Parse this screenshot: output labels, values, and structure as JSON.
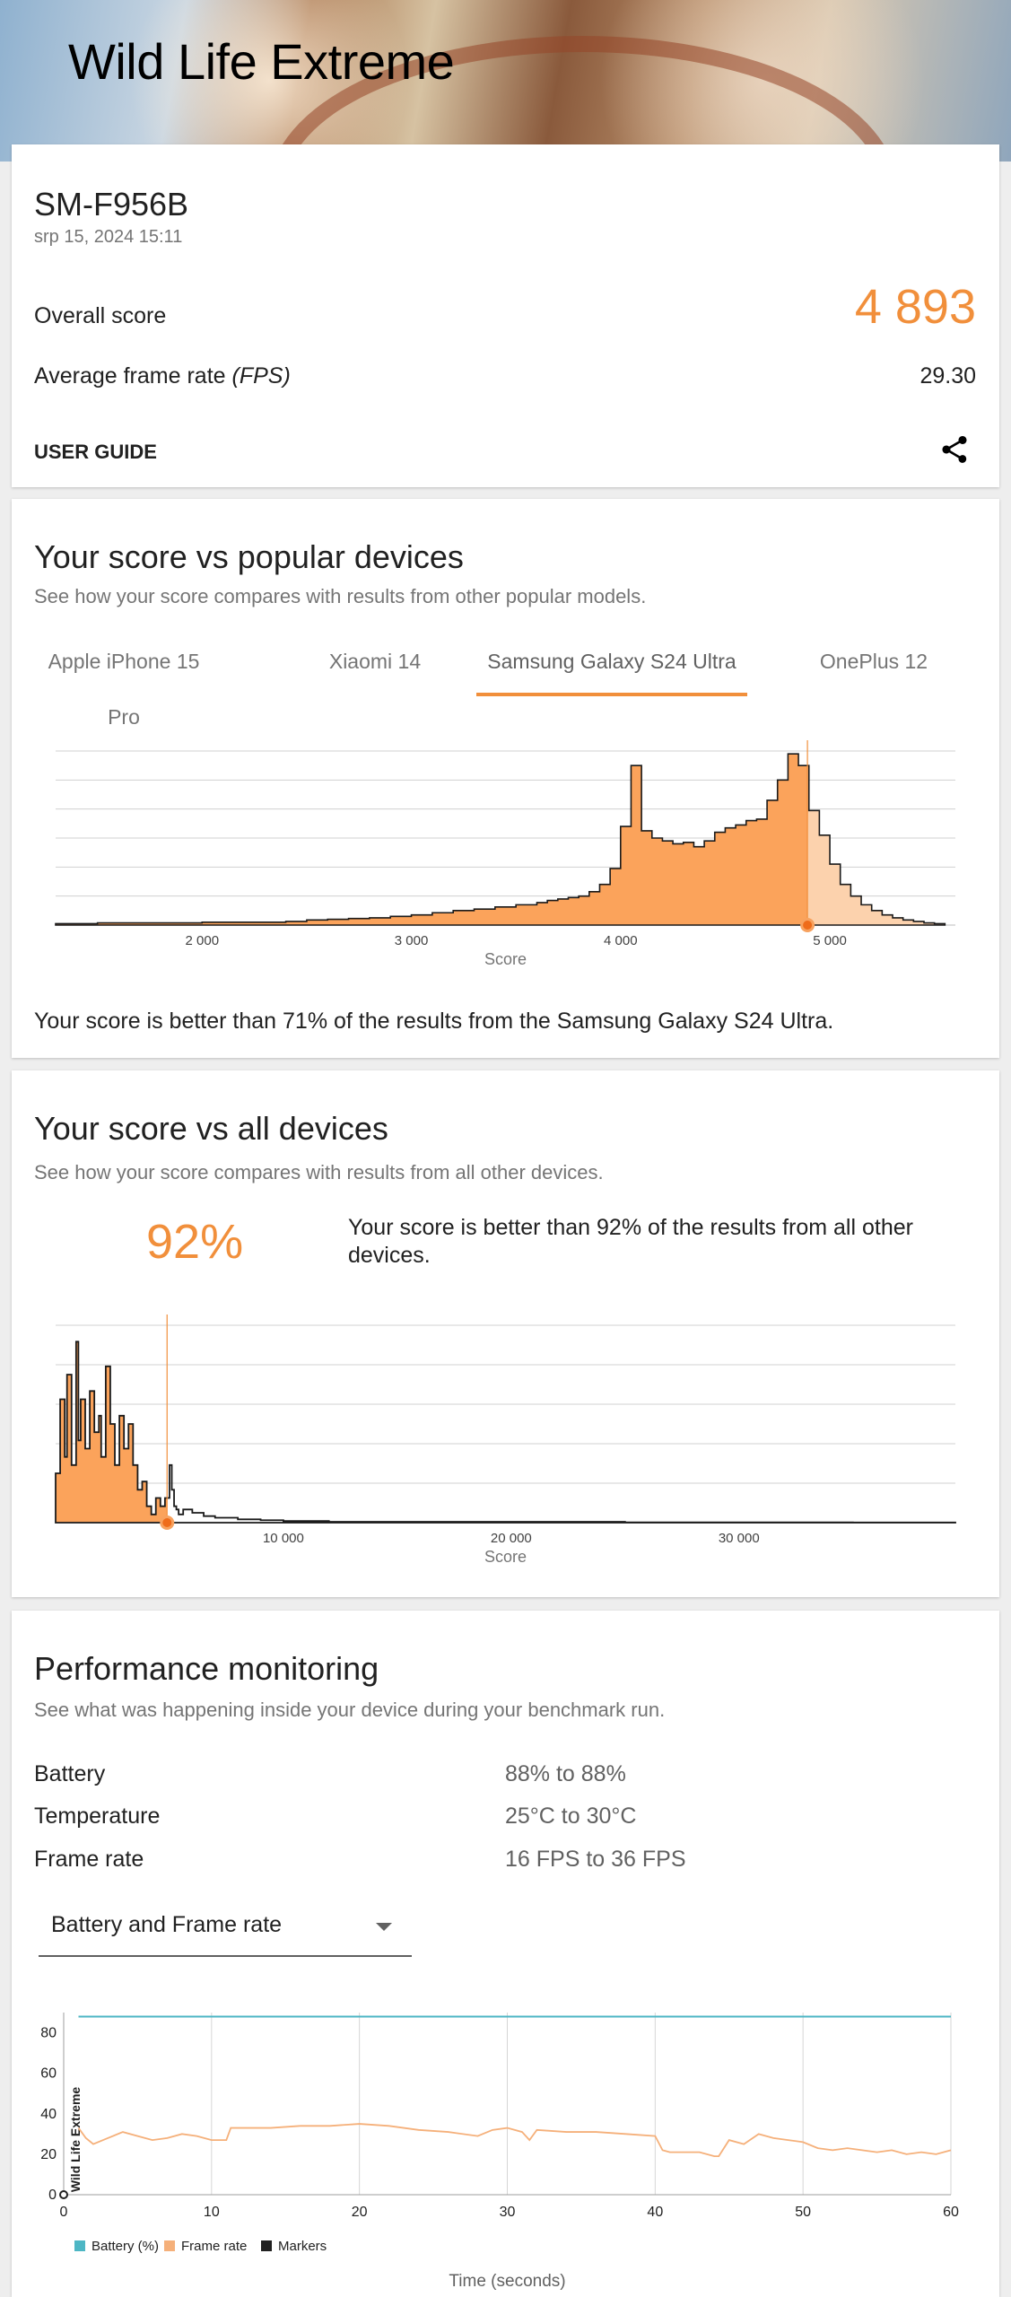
{
  "header": {
    "title": "Wild Life Extreme"
  },
  "summary": {
    "device": "SM-F956B",
    "date": "srp 15, 2024 15:11",
    "overall_label": "Overall score",
    "overall_value": "4 893",
    "fps_label": "Average frame rate",
    "fps_unit": "(FPS)",
    "fps_value": "29.30",
    "user_guide": "USER GUIDE",
    "share_icon": "share-icon",
    "accent_color": "#f18f3b"
  },
  "popular": {
    "title": "Your score vs popular devices",
    "subtitle": "See how your score compares with results from other popular models.",
    "tabs": [
      "Apple iPhone 15 Pro",
      "Xiaomi 14",
      "Samsung Galaxy S24 Ultra",
      "OnePlus 12"
    ],
    "active_tab": 2,
    "result_text": "Your score is better than 71% of the results from the Samsung Galaxy S24 Ultra."
  },
  "all_devices": {
    "title": "Your score vs all devices",
    "subtitle": "See how your score compares with results from all other devices.",
    "percent": "92%",
    "result_text": "Your score is better than 92% of the results from all other devices."
  },
  "performance": {
    "title": "Performance monitoring",
    "subtitle": "See what was happening inside your device during your benchmark run.",
    "rows": [
      {
        "label": "Battery",
        "value": "88% to 88%"
      },
      {
        "label": "Temperature",
        "value": "25°C to 30°C"
      },
      {
        "label": "Frame rate",
        "value": "16 FPS to 36 FPS"
      }
    ],
    "select_value": "Battery and Frame rate",
    "chevron_icon": "triangle-down-icon"
  },
  "chart_data": [
    {
      "type": "area",
      "xlabel": "Score",
      "xticks": [
        "2 000",
        "3 000",
        "4 000",
        "5 000"
      ],
      "xlim": [
        1300,
        5600
      ],
      "ylim": [
        0,
        12
      ],
      "your_score": 4893,
      "x": [
        1300,
        1500,
        1800,
        2000,
        2200,
        2400,
        2500,
        2600,
        2700,
        2800,
        2900,
        3000,
        3100,
        3200,
        3300,
        3400,
        3500,
        3600,
        3650,
        3700,
        3750,
        3800,
        3850,
        3900,
        3950,
        4000,
        4050,
        4100,
        4150,
        4200,
        4250,
        4300,
        4350,
        4400,
        4450,
        4500,
        4550,
        4600,
        4650,
        4700,
        4750,
        4800,
        4850,
        4900,
        4950,
        5000,
        5050,
        5100,
        5150,
        5200,
        5250,
        5300,
        5350,
        5400,
        5450,
        5500,
        5550
      ],
      "values": [
        0.1,
        0.15,
        0.15,
        0.2,
        0.2,
        0.25,
        0.35,
        0.4,
        0.45,
        0.5,
        0.6,
        0.7,
        0.85,
        1.0,
        1.1,
        1.25,
        1.4,
        1.55,
        1.7,
        1.8,
        1.9,
        2.0,
        2.3,
        2.8,
        3.9,
        6.8,
        11.0,
        6.5,
        6.0,
        5.8,
        5.6,
        5.7,
        5.4,
        5.8,
        6.4,
        6.7,
        6.9,
        7.2,
        7.3,
        8.6,
        10.0,
        11.8,
        11.0,
        7.9,
        6.2,
        4.2,
        2.8,
        2.0,
        1.4,
        1.0,
        0.7,
        0.5,
        0.35,
        0.25,
        0.15,
        0.1,
        0.05
      ]
    },
    {
      "type": "area",
      "xlabel": "Score",
      "xticks": [
        "10 000",
        "20 000",
        "30 000"
      ],
      "xlim": [
        0,
        39500
      ],
      "ylim": [
        0,
        12
      ],
      "your_score": 4893,
      "x": [
        0,
        200,
        400,
        500,
        700,
        900,
        1000,
        1100,
        1300,
        1500,
        1700,
        1900,
        2000,
        2200,
        2400,
        2600,
        2800,
        3000,
        3200,
        3400,
        3600,
        3800,
        4000,
        4200,
        4400,
        4600,
        4800,
        5000,
        5100,
        5200,
        5300,
        5400,
        5600,
        6000,
        6500,
        7000,
        8000,
        9000,
        10000,
        12000,
        15000,
        20000,
        25000,
        30000,
        35000,
        39500
      ],
      "values": [
        3.0,
        7.5,
        4.0,
        9.0,
        3.5,
        11.0,
        5.0,
        7.5,
        4.5,
        8.0,
        5.5,
        6.5,
        4.0,
        9.5,
        6.0,
        3.5,
        6.5,
        4.5,
        6.0,
        3.5,
        2.0,
        2.5,
        1.0,
        0.5,
        1.5,
        1.0,
        1.5,
        3.5,
        2.0,
        1.0,
        0.8,
        0.5,
        0.8,
        0.6,
        0.4,
        0.3,
        0.2,
        0.15,
        0.1,
        0.05,
        0.05,
        0.05,
        0.02,
        0.02,
        0.01,
        0.01
      ]
    },
    {
      "type": "line",
      "xlabel": "Time (seconds)",
      "ylabel": "Wild Life Extreme",
      "xlim": [
        0,
        60
      ],
      "ylim": [
        0,
        90
      ],
      "xticks": [
        0,
        10,
        20,
        30,
        40,
        50,
        60
      ],
      "yticks": [
        0,
        20,
        40,
        60,
        80
      ],
      "legend": [
        "Battery (%)",
        "Frame rate",
        "Markers"
      ],
      "legend_colors": [
        "#4db6c4",
        "#f5b07a",
        "#212121"
      ],
      "series": [
        {
          "name": "Battery (%)",
          "color": "#4db6c4",
          "x": [
            1,
            60
          ],
          "values": [
            88,
            88
          ]
        },
        {
          "name": "Frame rate",
          "color": "#f5b07a",
          "x": [
            1,
            1.5,
            2,
            3,
            4,
            5,
            6,
            7,
            8,
            9,
            10,
            11,
            11.3,
            12,
            14,
            16,
            18,
            20,
            22,
            24,
            26,
            28,
            29,
            30,
            31,
            31.5,
            32,
            34,
            36,
            38,
            40,
            40.5,
            41,
            42,
            43,
            44,
            44.3,
            45,
            46,
            47,
            48,
            49,
            50,
            51,
            52,
            53,
            54,
            55,
            56,
            57,
            58,
            59,
            60
          ],
          "values": [
            33,
            28,
            25,
            28,
            31,
            29,
            27,
            28,
            30,
            29,
            27,
            27,
            33,
            33,
            33,
            34,
            34,
            35,
            34,
            32,
            31,
            29,
            32,
            33,
            31,
            27,
            32,
            31,
            31,
            30,
            29,
            22,
            21,
            21,
            21,
            19,
            19,
            27,
            25,
            30,
            28,
            27,
            26,
            23,
            22,
            23,
            22,
            21,
            22,
            20,
            21,
            20,
            22
          ]
        }
      ]
    }
  ]
}
